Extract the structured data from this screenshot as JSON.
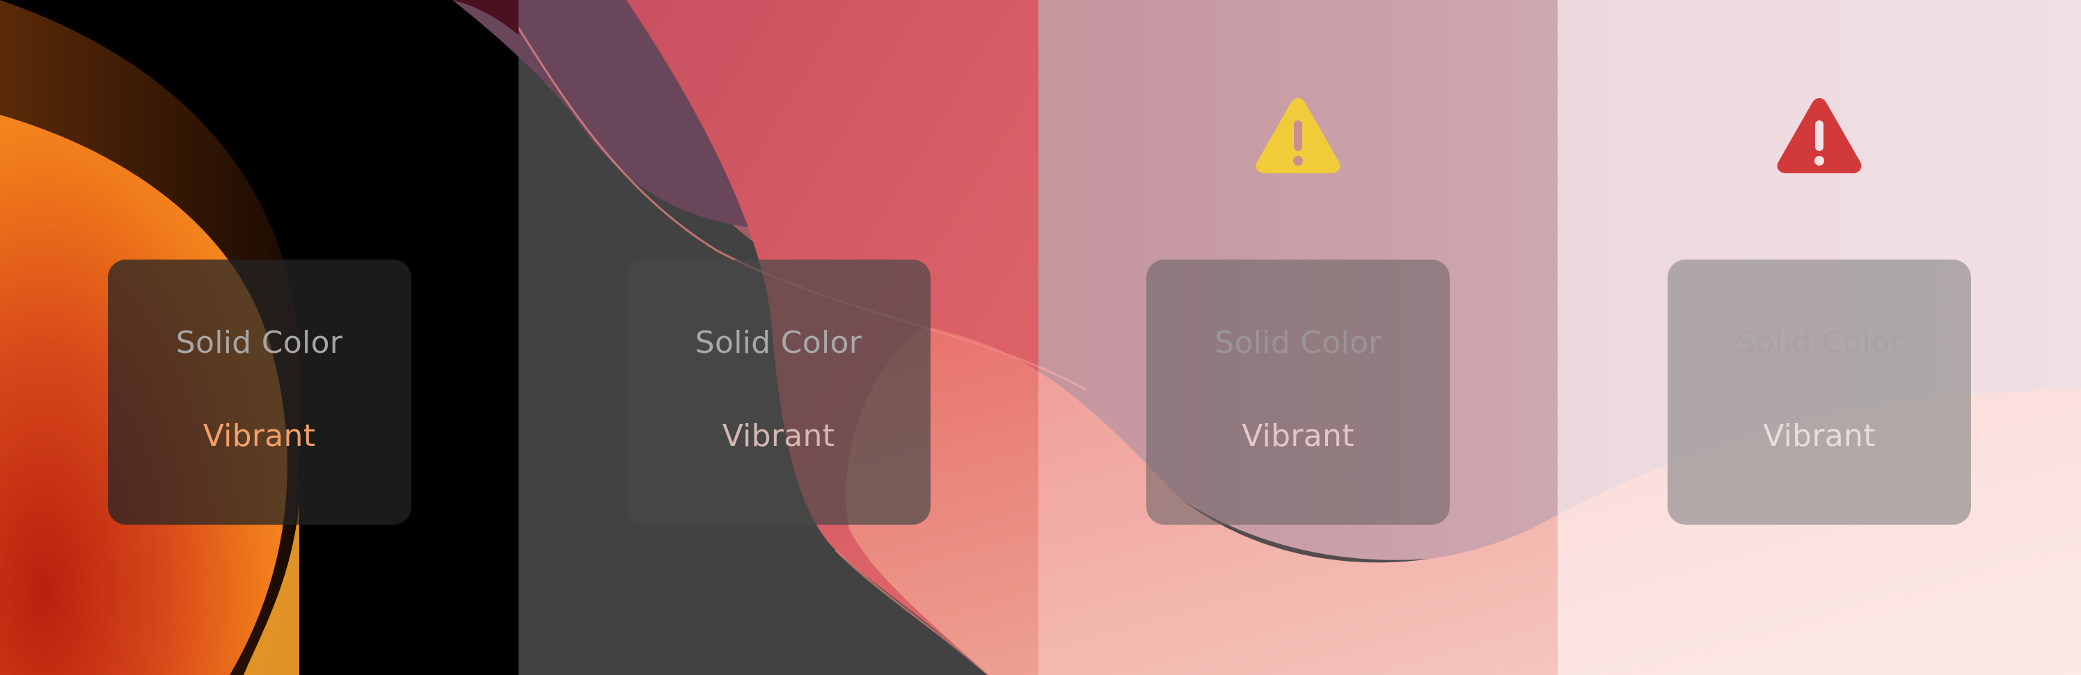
{
  "panels": [
    {
      "solid_label": "Solid Color",
      "vibrant_label": "Vibrant",
      "warning_icon": null
    },
    {
      "solid_label": "Solid Color",
      "vibrant_label": "Vibrant",
      "warning_icon": null
    },
    {
      "solid_label": "Solid Color",
      "vibrant_label": "Vibrant",
      "warning_icon": "warning-icon",
      "warning_color": "#f1cb3a"
    },
    {
      "solid_label": "Solid Color",
      "vibrant_label": "Vibrant",
      "warning_icon": "warning-icon",
      "warning_color": "#d2393b"
    }
  ],
  "colors": {
    "orange": "#f07a1a",
    "coral": "#e0606a",
    "dark_gray": "#424242"
  }
}
